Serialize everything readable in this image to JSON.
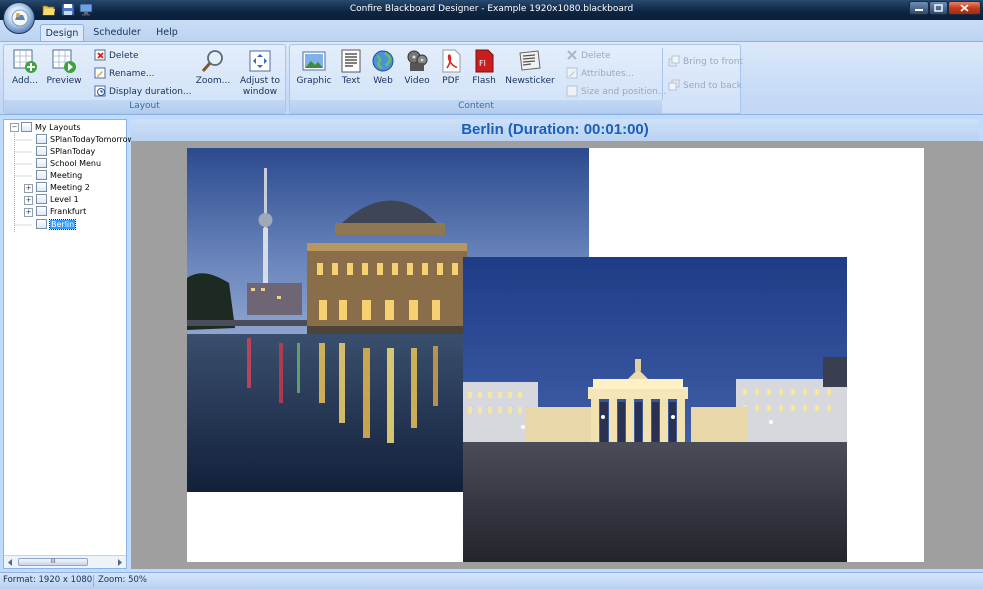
{
  "window": {
    "title": "Confire Blackboard Designer - Example 1920x1080.blackboard"
  },
  "tabs": [
    {
      "label": "Design",
      "active": true
    },
    {
      "label": "Scheduler",
      "active": false
    },
    {
      "label": "Help",
      "active": false
    }
  ],
  "ribbon": {
    "layout_group": {
      "label": "Layout",
      "add": "Add...",
      "preview": "Preview",
      "delete": "Delete",
      "rename": "Rename...",
      "display_duration": "Display duration...",
      "zoom": "Zoom...",
      "adjust_line1": "Adjust to",
      "adjust_line2": "window"
    },
    "content_group": {
      "label": "Content",
      "graphic": "Graphic",
      "text": "Text",
      "web": "Web",
      "video": "Video",
      "pdf": "PDF",
      "flash": "Flash",
      "newsticker": "Newsticker",
      "delete": "Delete",
      "attributes": "Attributes...",
      "size_position": "Size and position..."
    },
    "arrange": {
      "bring_front": "Bring to front",
      "send_back": "Send to back"
    }
  },
  "tree": {
    "root": "My Layouts",
    "items": [
      {
        "label": "SPlanTodayTomorrow",
        "expandable": false,
        "selected": false
      },
      {
        "label": "SPlanToday",
        "expandable": false,
        "selected": false
      },
      {
        "label": "School Menu",
        "expandable": false,
        "selected": false
      },
      {
        "label": "Meeting",
        "expandable": false,
        "selected": false
      },
      {
        "label": "Meeting 2",
        "expandable": true,
        "selected": false
      },
      {
        "label": "Level 1",
        "expandable": true,
        "selected": false
      },
      {
        "label": "Frankfurt",
        "expandable": true,
        "selected": false
      },
      {
        "label": "Berlin",
        "expandable": false,
        "selected": true
      }
    ],
    "scroll_thumb": "III"
  },
  "main": {
    "heading": "Berlin (Duration: 00:01:00)"
  },
  "status": {
    "format": "Format: 1920 x 1080",
    "zoom": "Zoom: 50%"
  },
  "colors": {
    "heading": "#1c5fb9",
    "ribbon_bg": "#c7dbf6",
    "titlebar": "#0e2644",
    "canvas_bg": "#9f9f9f",
    "selection": "#3399ff"
  }
}
